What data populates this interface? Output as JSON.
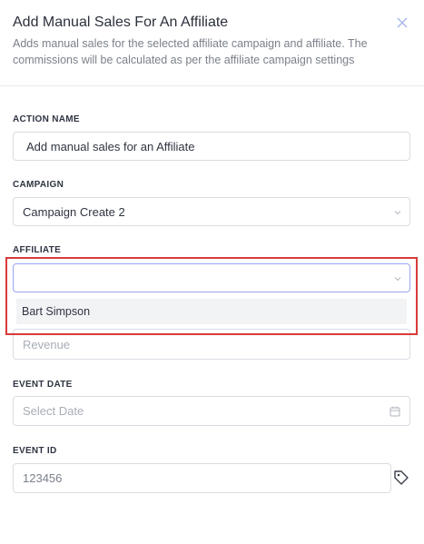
{
  "header": {
    "title": "Add Manual Sales For An Affiliate",
    "description": "Adds manual sales for the selected affiliate campaign and affiliate. The commissions will be calculated as per the affiliate campaign settings"
  },
  "action_name": {
    "label": "ACTION NAME",
    "value": "Add manual sales for an Affiliate"
  },
  "campaign": {
    "label": "CAMPAIGN",
    "value": "Campaign Create 2"
  },
  "affiliate": {
    "label": "AFFILIATE",
    "value": "",
    "options": [
      "Bart Simpson"
    ]
  },
  "revenue": {
    "placeholder": "Revenue"
  },
  "event_date": {
    "label": "EVENT DATE",
    "placeholder": "Select Date"
  },
  "event_id": {
    "label": "EVENT ID",
    "placeholder": "123456"
  },
  "icons": {
    "close": "close-icon",
    "chevron": "chevron-down-icon",
    "calendar": "calendar-icon",
    "tag": "tag-icon"
  },
  "colors": {
    "highlight": "#d93a3a",
    "focus_border": "#9aa6ee"
  }
}
